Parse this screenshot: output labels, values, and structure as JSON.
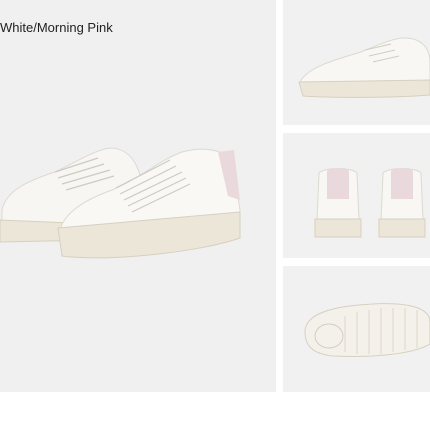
{
  "product": {
    "variant_label": "White/Morning Pink"
  },
  "images": [
    {
      "view": "pair-angle",
      "icon": "sneaker-pair-image"
    },
    {
      "view": "side",
      "icon": "sneaker-side-image"
    },
    {
      "view": "back",
      "icon": "sneaker-back-image"
    },
    {
      "view": "sole",
      "icon": "sneaker-sole-image"
    }
  ],
  "colors": {
    "shoe_white": "#f7f6f2",
    "sole_cream": "#ebe6d8",
    "accent_pink": "#ead9dc",
    "background": "#f1f1f1"
  }
}
